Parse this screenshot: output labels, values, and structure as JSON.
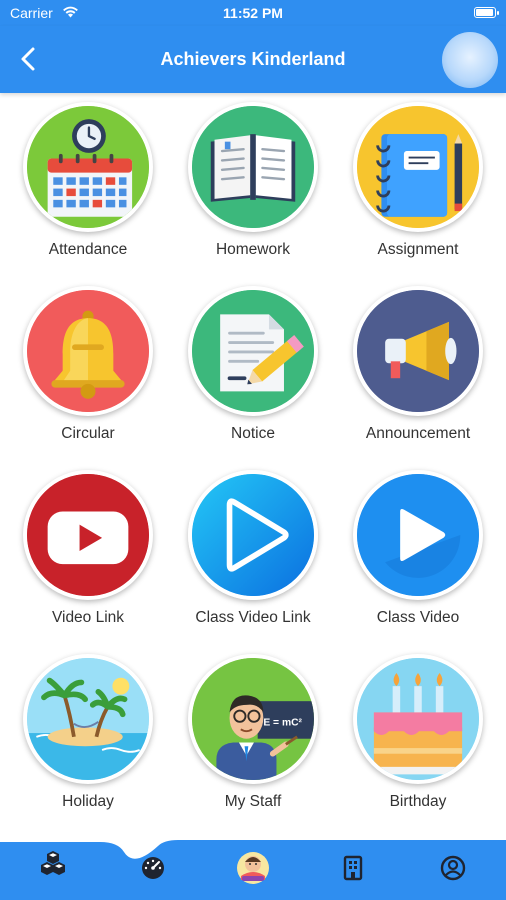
{
  "status": {
    "carrier": "Carrier",
    "time": "11:52 PM",
    "battery_level": 1.0
  },
  "header": {
    "title": "Achievers Kinderland"
  },
  "grid": [
    {
      "label": "Attendance"
    },
    {
      "label": "Homework"
    },
    {
      "label": "Assignment"
    },
    {
      "label": "Circular"
    },
    {
      "label": "Notice"
    },
    {
      "label": "Announcement"
    },
    {
      "label": "Video Link"
    },
    {
      "label": "Class Video Link"
    },
    {
      "label": "Class Video"
    },
    {
      "label": "Holiday"
    },
    {
      "label": "My Staff"
    },
    {
      "label": "Birthday"
    }
  ],
  "staff_board_text": "E = mC²",
  "tabs": [
    {
      "icon": "cubes-icon",
      "active": true
    },
    {
      "icon": "dashboard-gauge-icon",
      "active": false
    },
    {
      "icon": "school-logo-icon",
      "active": false
    },
    {
      "icon": "building-icon",
      "active": false
    },
    {
      "icon": "user-profile-icon",
      "active": false
    }
  ],
  "colors": {
    "primary": "#2F8EF0",
    "label": "#333333",
    "background": "#FFFFFF"
  }
}
